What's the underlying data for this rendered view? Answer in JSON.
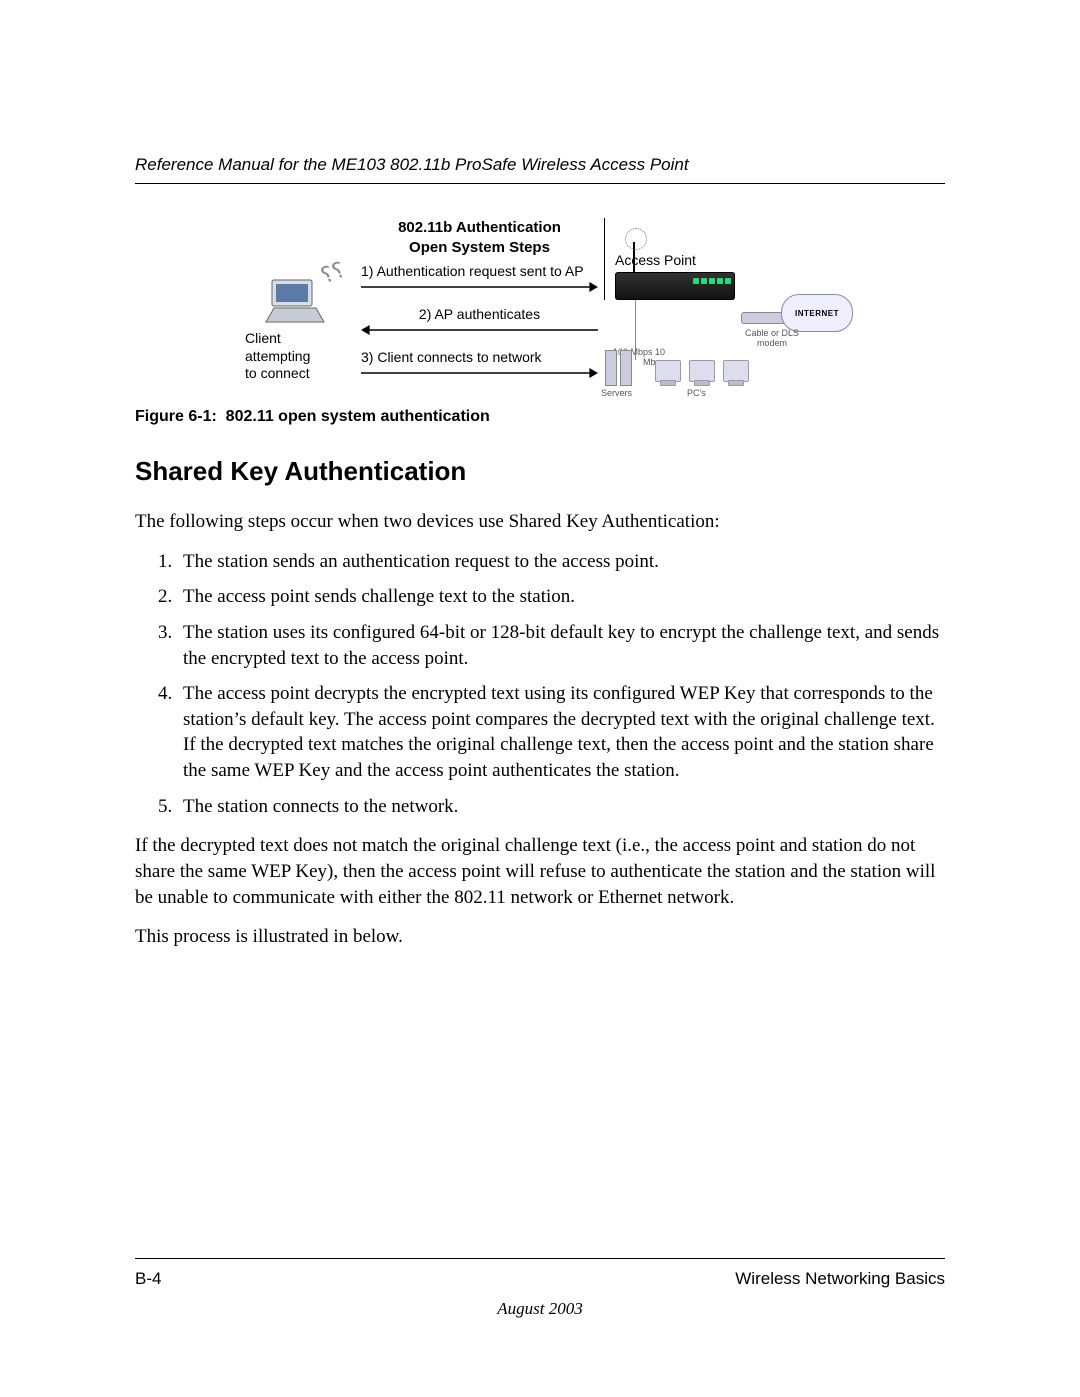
{
  "header": {
    "running_title": "Reference Manual for the ME103 802.11b ProSafe Wireless Access Point"
  },
  "figure": {
    "title_line1": "802.11b Authentication",
    "title_line2": "Open System Steps",
    "step1": "1) Authentication request sent to AP",
    "step2": "2) AP authenticates",
    "step3": "3) Client connects to network",
    "client_label_l1": "Client",
    "client_label_l2": "attempting",
    "client_label_l3": "to connect",
    "ap_label": "Access Point",
    "internet_label": "INTERNET",
    "modem_label": "Cable or\nDLS modem",
    "speed_label": "100 Mbps\n10 Mbps",
    "servers_label": "Servers",
    "pcs_label": "PC's",
    "caption": "Figure 6-1:  802.11 open system authentication"
  },
  "section": {
    "heading": "Shared Key Authentication",
    "intro": "The following steps occur when two devices use Shared Key Authentication:",
    "steps": [
      "The station sends an authentication request to the access point.",
      "The access point sends challenge text to the station.",
      "The station uses its configured 64-bit or 128-bit default key to encrypt the challenge text, and sends the encrypted text to the access point.",
      "The access point decrypts the encrypted text using its configured WEP Key that corresponds to the station’s default key. The access point compares the decrypted text with the original challenge text. If the decrypted text matches the original challenge text, then the access point and the station share the same WEP Key and the access point authenticates the station.",
      "The station connects to the network."
    ],
    "para_after": "If the decrypted text does not match the original challenge text (i.e., the access point and station do not share the same WEP Key), then the access point will refuse to authenticate the station and the station will be unable to communicate with either the 802.11 network or Ethernet network.",
    "para_last": "This process is illustrated in below."
  },
  "footer": {
    "page_number": "B-4",
    "section_name": "Wireless Networking Basics",
    "date": "August 2003"
  }
}
